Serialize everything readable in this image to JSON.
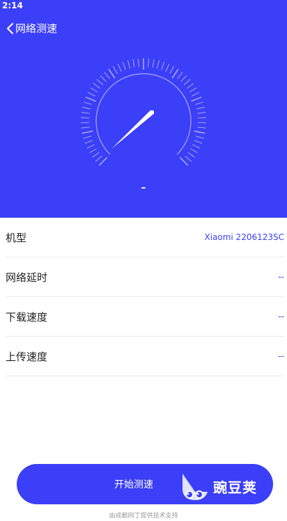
{
  "status_bar": {
    "time": "2:14"
  },
  "header": {
    "title": "网络测速",
    "gauge_value": "–",
    "colors": {
      "background": "#3b3ff7",
      "foreground": "#ffffff"
    }
  },
  "info": {
    "rows": [
      {
        "label": "机型",
        "value": "Xiaomi 2206123SC"
      },
      {
        "label": "网络延时",
        "value": "--"
      },
      {
        "label": "下载速度",
        "value": "--"
      },
      {
        "label": "上传速度",
        "value": "--"
      }
    ]
  },
  "actions": {
    "start_label": "开始测速"
  },
  "watermark": {
    "text": "豌豆荚"
  },
  "footer": {
    "note": "由成都网丁提供技术支持"
  }
}
